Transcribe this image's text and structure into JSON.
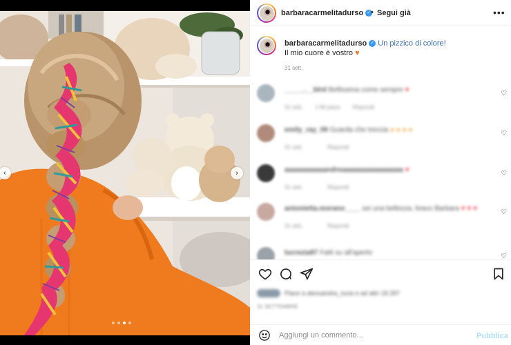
{
  "post": {
    "username": "barbaracarmelitadurso",
    "follow_separator": "•",
    "follow_label": "Segui già",
    "more_label": "•••",
    "caption_line1": "Un pizzico di colore!",
    "caption_line2": "Il mio cuore è vostro",
    "caption_heart": "♥",
    "caption_time": "31 sett.",
    "verified_glyph": "✓"
  },
  "carousel": {
    "prev_glyph": "‹",
    "next_glyph": "›",
    "slide_count": 4,
    "active_slide": 2
  },
  "comments": [
    {
      "user": "_____.__blrd",
      "text": "Bellissima come sempre",
      "emoji": "♥",
      "emoji_color": "red",
      "time": "31 sett.",
      "likes": "1 Mi piace",
      "reply": "Rispondi"
    },
    {
      "user": "emily_ray_09",
      "text": "Guarda che treccia",
      "emoji": "● ● ● ●",
      "emoji_color": "orange",
      "time": "31 sett.",
      "likes": "",
      "reply": "Rispondi"
    },
    {
      "user": "aaaaaaaaaaandreaaaaaaaaaaaaaaaa",
      "text": "",
      "emoji": "♥",
      "emoji_color": "red",
      "time": "31 sett.",
      "likes": "",
      "reply": "Rispondi"
    },
    {
      "user": "antonietta.morano____",
      "text": "sei una bellezza, bravo Barbara",
      "emoji": "♥ ♥ ♥",
      "emoji_color": "red",
      "time": "31 sett.",
      "likes": "",
      "reply": "Rispondi"
    },
    {
      "user": "lucrezia87",
      "text": "Fatti su all'aperto",
      "emoji": "",
      "emoji_color": "",
      "time": "",
      "likes": "",
      "reply": ""
    }
  ],
  "likes_summary": "Piace a alessandra_lucia e ad altri 18.397",
  "post_timestamp": "31 SETTEMBRE",
  "add_comment": {
    "placeholder": "Aggiungi un commento...",
    "publish_label": "Pubblica"
  },
  "colors": {
    "verified": "#3897f0",
    "caption_link": "#3a6fb0",
    "heart_orange": "#f2792b",
    "publish_disabled": "#b2dffc"
  }
}
